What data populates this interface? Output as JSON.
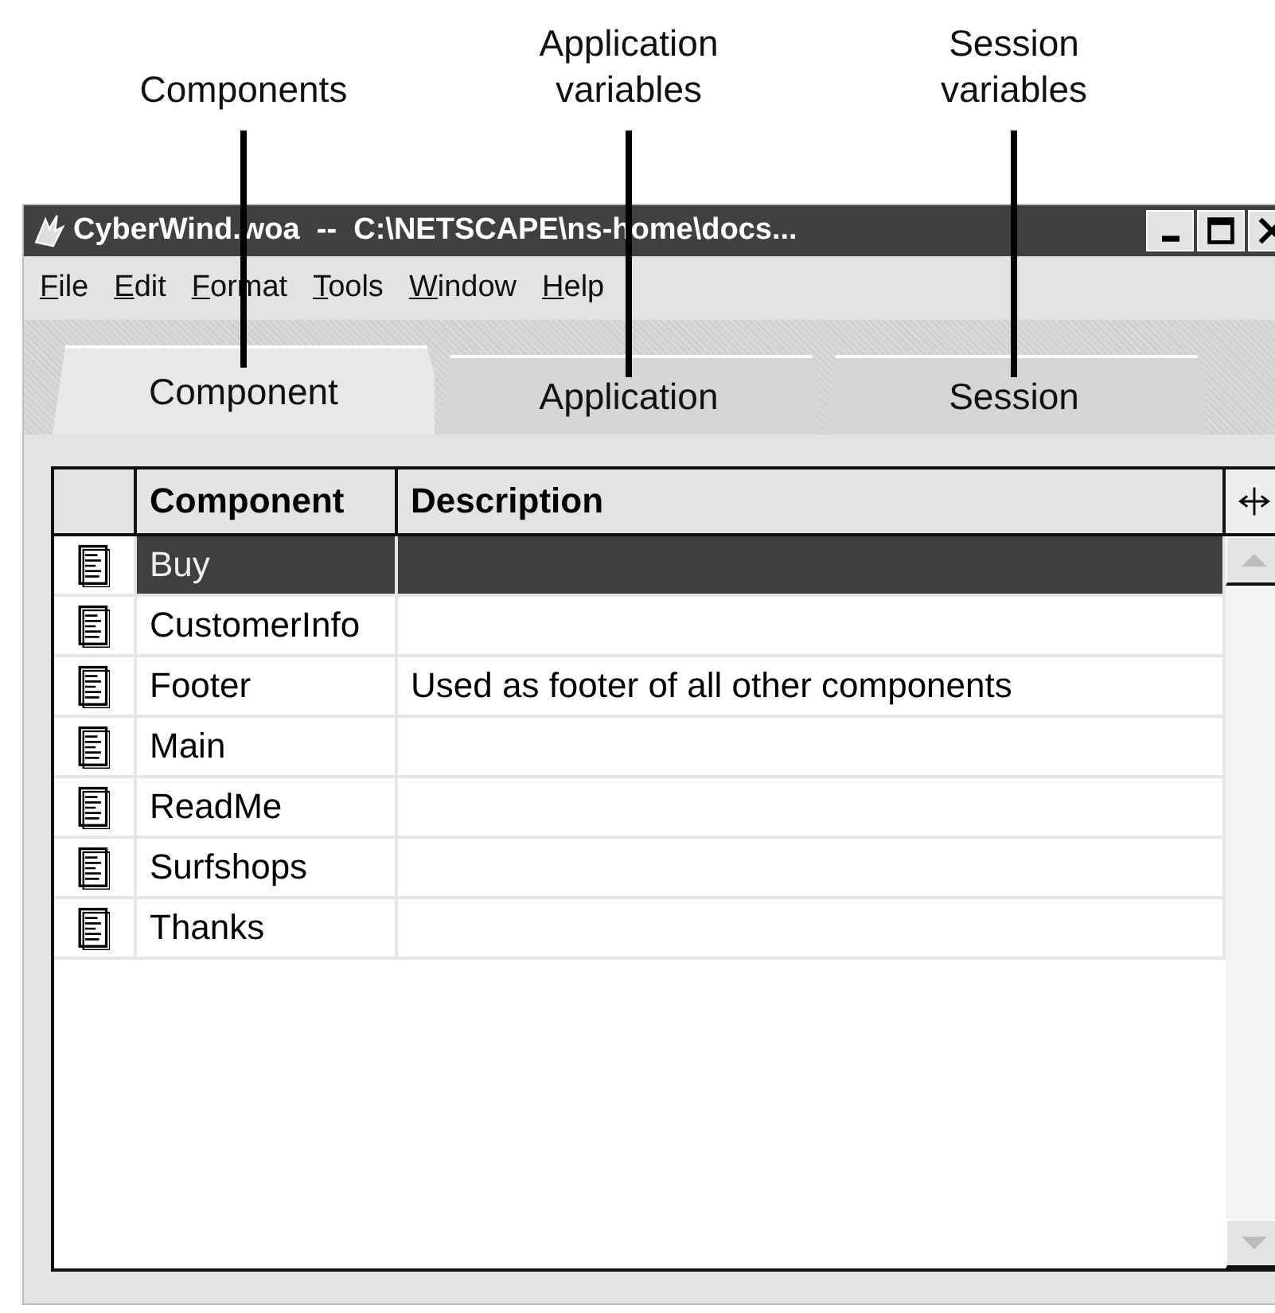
{
  "callouts": [
    {
      "label": "Components"
    },
    {
      "label": "Application\nvariables"
    },
    {
      "label": "Session\nvariables"
    }
  ],
  "window": {
    "title": "CyberWind.woa  --  C:\\NETSCAPE\\ns-home\\docs..."
  },
  "menu": [
    {
      "label": "File"
    },
    {
      "label": "Edit"
    },
    {
      "label": "Format"
    },
    {
      "label": "Tools"
    },
    {
      "label": "Window"
    },
    {
      "label": "Help"
    }
  ],
  "tabs": [
    {
      "label": "Component",
      "selected": true
    },
    {
      "label": "Application",
      "selected": false
    },
    {
      "label": "Session",
      "selected": false
    }
  ],
  "table": {
    "columns": [
      "Component",
      "Description"
    ],
    "rows": [
      {
        "name": "Buy",
        "selected": true
      },
      {
        "name": "CustomerInfo",
        "selected": false
      },
      {
        "name": "Footer",
        "description": "Used as footer of all other components",
        "selected": false
      },
      {
        "name": "Main",
        "selected": false
      },
      {
        "name": "ReadMe",
        "selected": false
      },
      {
        "name": "Surfshops",
        "selected": false
      },
      {
        "name": "Thanks",
        "selected": false
      }
    ]
  }
}
